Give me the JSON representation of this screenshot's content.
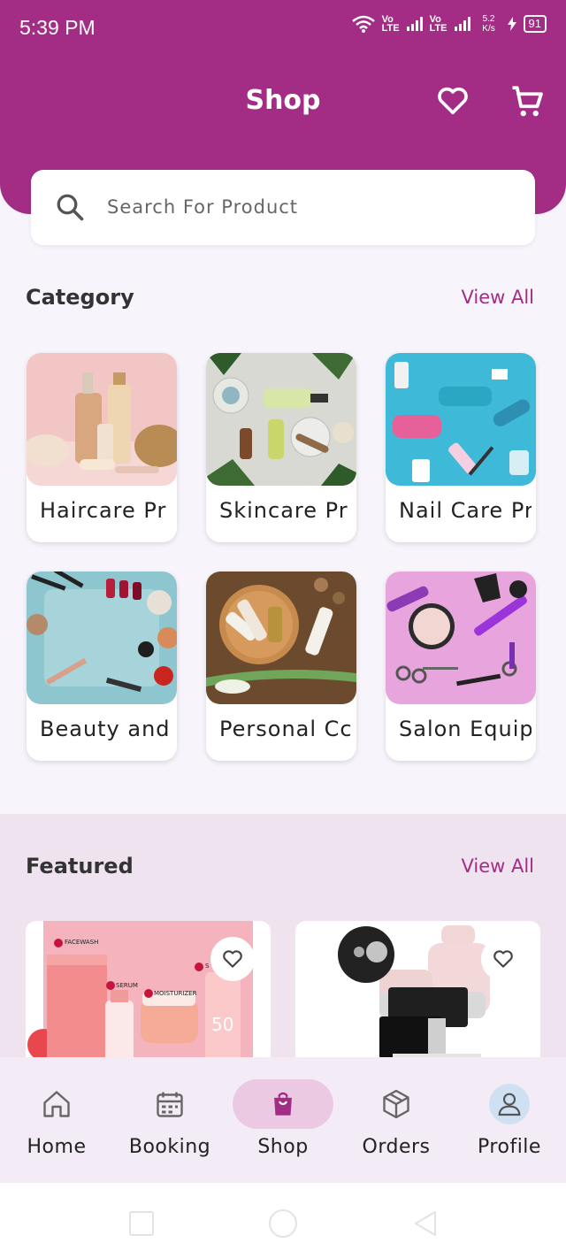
{
  "status_bar": {
    "time": "5:39 PM",
    "speed": "5.2 K/s",
    "battery": "91"
  },
  "header": {
    "title": "Shop"
  },
  "search": {
    "placeholder": "Search For Product"
  },
  "category": {
    "heading": "Category",
    "view_all": "View All",
    "items": [
      {
        "label": "Haircare Pr"
      },
      {
        "label": "Skincare Pr"
      },
      {
        "label": "Nail Care Pr"
      },
      {
        "label": "Beauty and"
      },
      {
        "label": "Personal Cc"
      },
      {
        "label": "Salon Equip"
      }
    ]
  },
  "featured": {
    "heading": "Featured",
    "view_all": "View All",
    "product1_tags": [
      "FACEWASH",
      "SERUM",
      "MOISTURIZER",
      "S"
    ],
    "product1_spf": "50"
  },
  "bottom_nav": {
    "items": [
      {
        "label": "Home"
      },
      {
        "label": "Booking"
      },
      {
        "label": "Shop"
      },
      {
        "label": "Orders"
      },
      {
        "label": "Profile"
      }
    ],
    "active": "Shop"
  },
  "colors": {
    "brand": "#a32d85",
    "background": "#f7f5fb",
    "featured_bg": "#efe3f0"
  }
}
